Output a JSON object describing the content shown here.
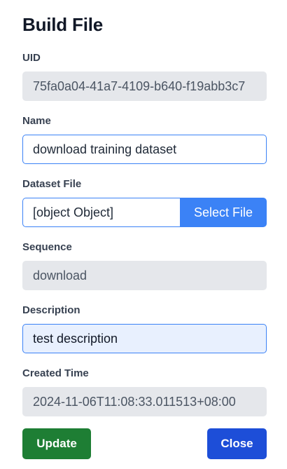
{
  "dialog": {
    "title": "Build File"
  },
  "fields": {
    "uid": {
      "label": "UID",
      "value": "75fa0a04-41a7-4109-b640-f19abb3c7"
    },
    "name": {
      "label": "Name",
      "value": "download training dataset"
    },
    "dataset_file": {
      "label": "Dataset File",
      "value": "[object Object]",
      "button_label": "Select File"
    },
    "sequence": {
      "label": "Sequence",
      "value": "download"
    },
    "description": {
      "label": "Description",
      "value": "test description"
    },
    "created_time": {
      "label": "Created Time",
      "value": "2024-11-06T11:08:33.011513+08:00"
    }
  },
  "actions": {
    "update_label": "Update",
    "close_label": "Close"
  },
  "colors": {
    "primary": "#3b82f6",
    "update_button": "#1e7e34",
    "close_button": "#1d4ed8",
    "readonly_bg": "#e5e7eb",
    "active_bg": "#e8f0fe"
  }
}
